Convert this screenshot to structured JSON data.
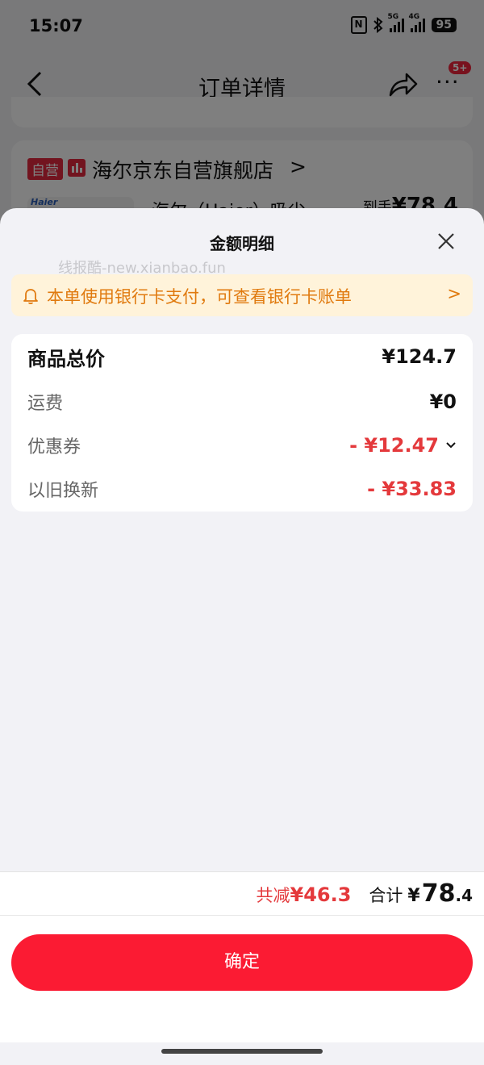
{
  "status_bar": {
    "time": "15:07",
    "net1": "5G",
    "net2": "4G",
    "battery": "95"
  },
  "nav": {
    "title": "订单详情",
    "badge": "5+"
  },
  "store": {
    "self_tag": "自营",
    "name": "海尔京东自营旗舰店",
    "chevron": ">"
  },
  "product": {
    "brand_logo": "Haier",
    "name": "海尔（Haier）吸尘",
    "price_label": "到手",
    "price": "¥78.4"
  },
  "sheet": {
    "title": "金额明细",
    "watermark": "线报酷-new.xianbao.fun",
    "notice": "本单使用银行卡支付，可查看银行卡账单",
    "notice_chevron": ">",
    "rows": [
      {
        "label": "商品总价",
        "value": "¥124.7"
      },
      {
        "label": "运费",
        "value": "¥0"
      },
      {
        "label": "优惠券",
        "value": "- ¥12.47"
      },
      {
        "label": "以旧换新",
        "value": "- ¥33.83"
      }
    ]
  },
  "footer": {
    "reduce_label": "共减",
    "reduce_value": "¥46.3",
    "total_label": "合计",
    "total_yen": "¥",
    "total_int": "78",
    "total_dec": ".4",
    "confirm": "确定"
  },
  "colors": {
    "red": "#e4393c",
    "button": "#fb1b33",
    "notice_bg": "#fff3da",
    "notice_text": "#e07a0f"
  }
}
